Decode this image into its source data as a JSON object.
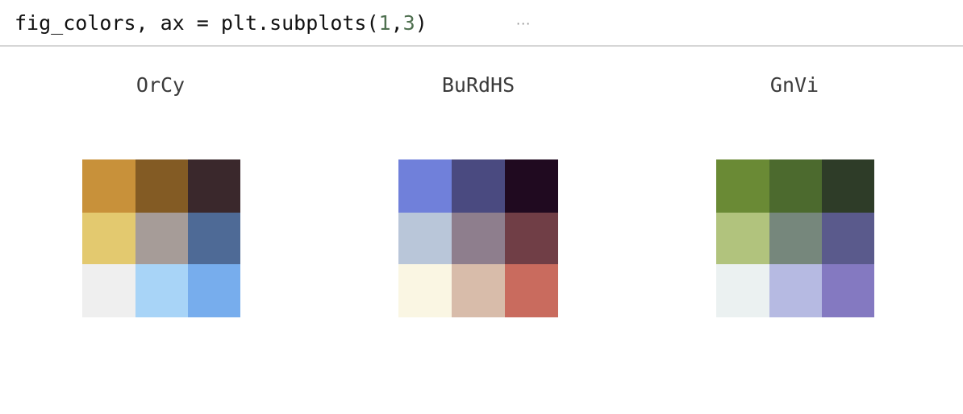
{
  "code": {
    "prefix": "fig_colors, ax = plt.subplots(",
    "arg1": "1",
    "comma": ",",
    "arg2": "3",
    "suffix": ")",
    "collapsed_indicator": "···"
  },
  "subplots": [
    {
      "title": "OrCy",
      "colors": [
        [
          "#c8913a",
          "#835b24",
          "#3a282c"
        ],
        [
          "#e3c96f",
          "#a69c98",
          "#4e6a96"
        ],
        [
          "#efefef",
          "#a8d4f7",
          "#77aded"
        ]
      ]
    },
    {
      "title": "BuRdHS",
      "colors": [
        [
          "#7080da",
          "#4a4a80",
          "#200a20"
        ],
        [
          "#b9c6d9",
          "#8e7e8d",
          "#703e46"
        ],
        [
          "#faf6e3",
          "#d8bcaa",
          "#c96b5e"
        ]
      ]
    },
    {
      "title": "GnVi",
      "colors": [
        [
          "#6a8a35",
          "#4c6a2e",
          "#2e3c28"
        ],
        [
          "#b1c37d",
          "#76877c",
          "#5a5a8c"
        ],
        [
          "#ebf1f1",
          "#b6bae2",
          "#8479c1"
        ]
      ]
    }
  ]
}
